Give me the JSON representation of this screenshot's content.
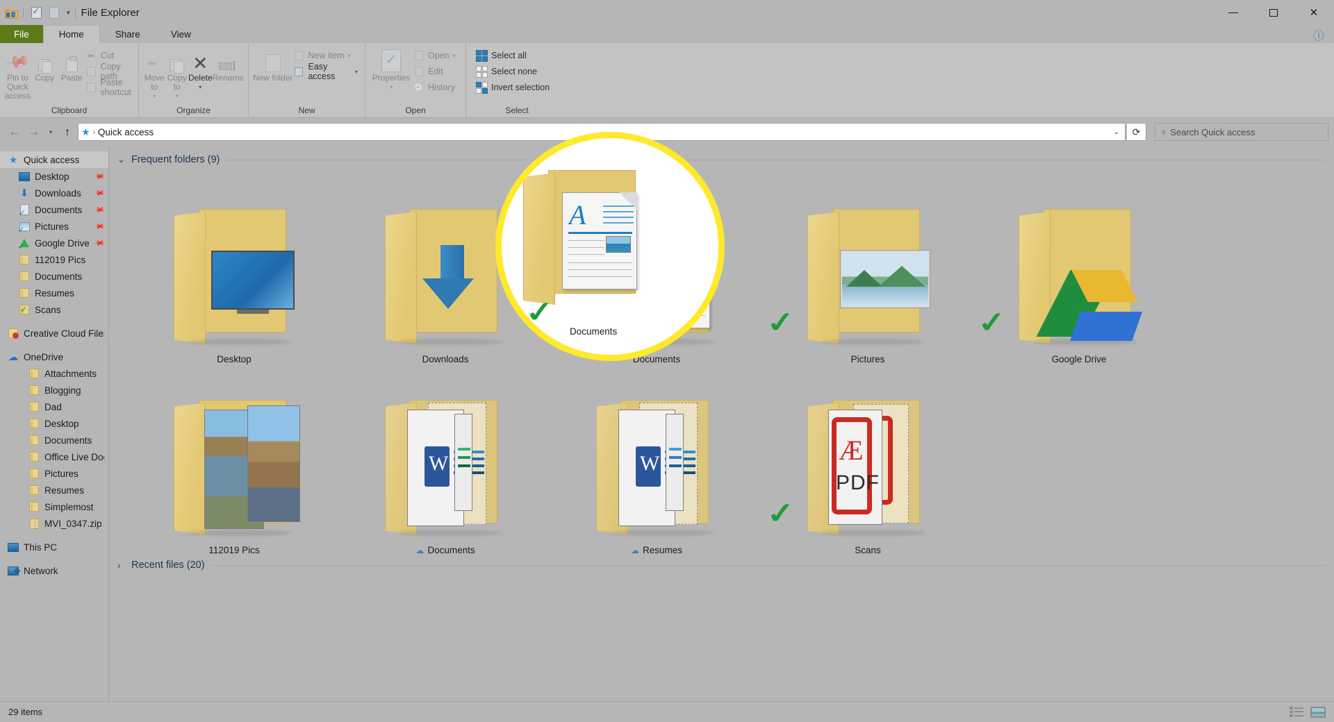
{
  "window": {
    "title": "File Explorer",
    "quick_access_toolbar": [
      {
        "name": "folder-icon",
        "label": "Explorer"
      },
      {
        "name": "properties-icon",
        "label": "Properties"
      },
      {
        "name": "new-folder-icon",
        "label": "New folder"
      },
      {
        "name": "chevron-down-icon",
        "label": "Customize Quick Access Toolbar"
      }
    ],
    "controls": {
      "minimize": "Minimize",
      "maximize": "Maximize",
      "close": "Close"
    }
  },
  "ribbon": {
    "tabs": [
      {
        "label": "File",
        "type": "file"
      },
      {
        "label": "Home",
        "type": "active"
      },
      {
        "label": "Share",
        "type": "normal"
      },
      {
        "label": "View",
        "type": "normal"
      }
    ],
    "help_icon": "help-icon",
    "groups": [
      {
        "label": "Clipboard",
        "big": [
          {
            "label": "Pin to Quick access",
            "icon": "pin-icon"
          },
          {
            "label": "Copy",
            "icon": "copy-icon"
          },
          {
            "label": "Paste",
            "icon": "paste-icon"
          }
        ],
        "small": [
          {
            "label": "Cut",
            "icon": "scissors-icon"
          },
          {
            "label": "Copy path",
            "icon": "copy-path-icon"
          },
          {
            "label": "Paste shortcut",
            "icon": "paste-shortcut-icon"
          }
        ]
      },
      {
        "label": "Organize",
        "big": [
          {
            "label": "Move to",
            "icon": "move-to-icon",
            "dropdown": true
          },
          {
            "label": "Copy to",
            "icon": "copy-to-icon",
            "dropdown": true
          },
          {
            "label": "Delete",
            "icon": "delete-icon",
            "dropdown": true
          },
          {
            "label": "Rename",
            "icon": "rename-icon"
          }
        ],
        "small": []
      },
      {
        "label": "New",
        "big": [
          {
            "label": "New folder",
            "icon": "new-folder-icon"
          }
        ],
        "small": [
          {
            "label": "New item",
            "icon": "new-item-icon",
            "dropdown": true
          },
          {
            "label": "Easy access",
            "icon": "easy-access-icon",
            "dropdown": true
          }
        ]
      },
      {
        "label": "Open",
        "big": [
          {
            "label": "Properties",
            "icon": "properties-icon",
            "dropdown": true
          }
        ],
        "small": [
          {
            "label": "Open",
            "icon": "open-icon",
            "dropdown": true
          },
          {
            "label": "Edit",
            "icon": "edit-icon"
          },
          {
            "label": "History",
            "icon": "history-icon"
          }
        ]
      },
      {
        "label": "Select",
        "big": [],
        "small": [
          {
            "label": "Select all",
            "icon": "select-all-icon"
          },
          {
            "label": "Select none",
            "icon": "select-none-icon"
          },
          {
            "label": "Invert selection",
            "icon": "invert-selection-icon"
          }
        ]
      }
    ]
  },
  "navbar": {
    "back": "Back",
    "forward": "Forward",
    "recent": "Recent locations",
    "up": "Up",
    "breadcrumb_icon": "quick-access-star-icon",
    "breadcrumb": "Quick access",
    "dropdown_icon": "chevron-down-icon",
    "refresh_icon": "refresh-icon",
    "search_placeholder": "Search Quick access",
    "search_icon": "search-icon"
  },
  "sidebar": [
    {
      "label": "Quick access",
      "icon": "star-icon",
      "indent": 0,
      "selected": true,
      "pinned": false
    },
    {
      "label": "Desktop",
      "icon": "desktop-icon",
      "indent": 1,
      "selected": false,
      "pinned": true
    },
    {
      "label": "Downloads",
      "icon": "downloads-icon",
      "indent": 1,
      "selected": false,
      "pinned": true
    },
    {
      "label": "Documents",
      "icon": "documents-icon",
      "indent": 1,
      "selected": false,
      "pinned": true
    },
    {
      "label": "Pictures",
      "icon": "pictures-icon",
      "indent": 1,
      "selected": false,
      "pinned": true
    },
    {
      "label": "Google Drive",
      "icon": "google-drive-icon",
      "indent": 1,
      "selected": false,
      "pinned": true
    },
    {
      "label": "112019 Pics",
      "icon": "folder-icon",
      "indent": 1,
      "selected": false,
      "pinned": false
    },
    {
      "label": "Documents",
      "icon": "folder-icon",
      "indent": 1,
      "selected": false,
      "pinned": false
    },
    {
      "label": "Resumes",
      "icon": "folder-icon",
      "indent": 1,
      "selected": false,
      "pinned": false
    },
    {
      "label": "Scans",
      "icon": "folder-sync-icon",
      "indent": 1,
      "selected": false,
      "pinned": false
    },
    {
      "label": "Creative Cloud Files",
      "icon": "creative-cloud-icon",
      "indent": 0,
      "selected": false,
      "pinned": false,
      "gap_before": true
    },
    {
      "label": "OneDrive",
      "icon": "onedrive-cloud-icon",
      "indent": 0,
      "selected": false,
      "pinned": false,
      "gap_before": true
    },
    {
      "label": "Attachments",
      "icon": "folder-icon",
      "indent": 2,
      "selected": false,
      "pinned": false
    },
    {
      "label": "Blogging",
      "icon": "folder-icon",
      "indent": 2,
      "selected": false,
      "pinned": false
    },
    {
      "label": "Dad",
      "icon": "folder-icon",
      "indent": 2,
      "selected": false,
      "pinned": false
    },
    {
      "label": "Desktop",
      "icon": "folder-icon",
      "indent": 2,
      "selected": false,
      "pinned": false
    },
    {
      "label": "Documents",
      "icon": "folder-icon",
      "indent": 2,
      "selected": false,
      "pinned": false
    },
    {
      "label": "Office Live Docume",
      "icon": "folder-icon",
      "indent": 2,
      "selected": false,
      "pinned": false
    },
    {
      "label": "Pictures",
      "icon": "folder-icon",
      "indent": 2,
      "selected": false,
      "pinned": false
    },
    {
      "label": "Resumes",
      "icon": "folder-icon",
      "indent": 2,
      "selected": false,
      "pinned": false
    },
    {
      "label": "Simplemost",
      "icon": "folder-icon",
      "indent": 2,
      "selected": false,
      "pinned": false
    },
    {
      "label": "MVI_0347.zip",
      "icon": "zip-icon",
      "indent": 2,
      "selected": false,
      "pinned": false
    },
    {
      "label": "This PC",
      "icon": "this-pc-icon",
      "indent": 0,
      "selected": false,
      "pinned": false,
      "gap_before": true
    },
    {
      "label": "Network",
      "icon": "network-icon",
      "indent": 0,
      "selected": false,
      "pinned": false,
      "gap_before": true
    }
  ],
  "content": {
    "frequent_folders_header": "Frequent folders (9)",
    "recent_files_header": "Recent files (20)",
    "frequent_folders": [
      {
        "label": "Desktop",
        "art": "desktop",
        "checked": false,
        "cloud": false
      },
      {
        "label": "Downloads",
        "art": "downloads",
        "checked": false,
        "cloud": false
      },
      {
        "label": "Documents",
        "art": "documents",
        "checked": true,
        "cloud": false,
        "highlighted": true
      },
      {
        "label": "Pictures",
        "art": "pictures",
        "checked": true,
        "cloud": false
      },
      {
        "label": "Google Drive",
        "art": "gdrive",
        "checked": true,
        "cloud": false
      },
      {
        "label": "112019 Pics",
        "art": "pics",
        "checked": false,
        "cloud": false
      },
      {
        "label": "Documents",
        "art": "onedrive-docs",
        "checked": false,
        "cloud": true
      },
      {
        "label": "Resumes",
        "art": "onedrive-docs",
        "checked": false,
        "cloud": true
      },
      {
        "label": "Scans",
        "art": "scans-pdf",
        "checked": true,
        "cloud": false
      }
    ]
  },
  "statusbar": {
    "item_count": "29 items",
    "view_details": "Details view",
    "view_large_icons": "Large icons view"
  },
  "colors": {
    "window_bg": "#b6b6b6",
    "ribbon_bg": "#c3c3c3",
    "file_tab": "#5b7a1a",
    "accent_blue": "#2b7fb8",
    "highlight_ring": "#ffe92b",
    "check_green": "#1f9b39",
    "folder_yellow": "#e3c873"
  }
}
